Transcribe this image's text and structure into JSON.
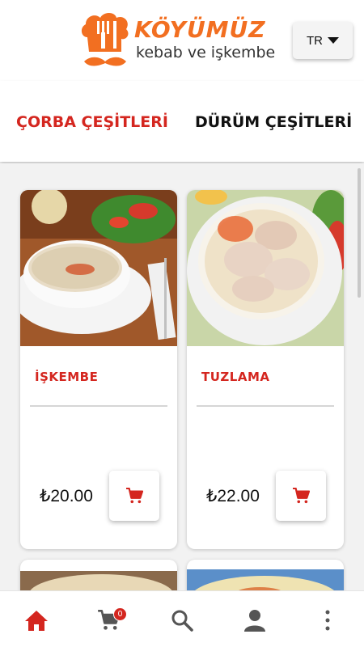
{
  "brand": {
    "name": "KÖYÜMÜZ",
    "tagline": "kebab ve işkembe",
    "accent_color": "#f26f21",
    "badge_icon": "chef-hat-cutlery-mustache-logo"
  },
  "language": {
    "selected": "TR",
    "icon": "caret-down-icon"
  },
  "tabs": [
    {
      "label": "ÇORBA ÇEŞİTLERİ",
      "active": true
    },
    {
      "label": "DÜRÜM ÇEŞİTLERİ",
      "active": false
    }
  ],
  "products": [
    {
      "name": "İŞKEMBE",
      "price": "₺20.00",
      "image": "iskembe-soup-bowl-photo"
    },
    {
      "name": "TUZLAMA",
      "price": "₺22.00",
      "image": "tuzlama-soup-bowl-photo"
    }
  ],
  "bottom_nav": {
    "items": [
      "home-icon",
      "cart-icon",
      "search-icon",
      "user-icon",
      "more-vertical-icon"
    ],
    "cart_count": "0",
    "active_color": "#d4261f"
  },
  "colors": {
    "accent_red": "#d4261f",
    "background": "#f2f2f2"
  }
}
